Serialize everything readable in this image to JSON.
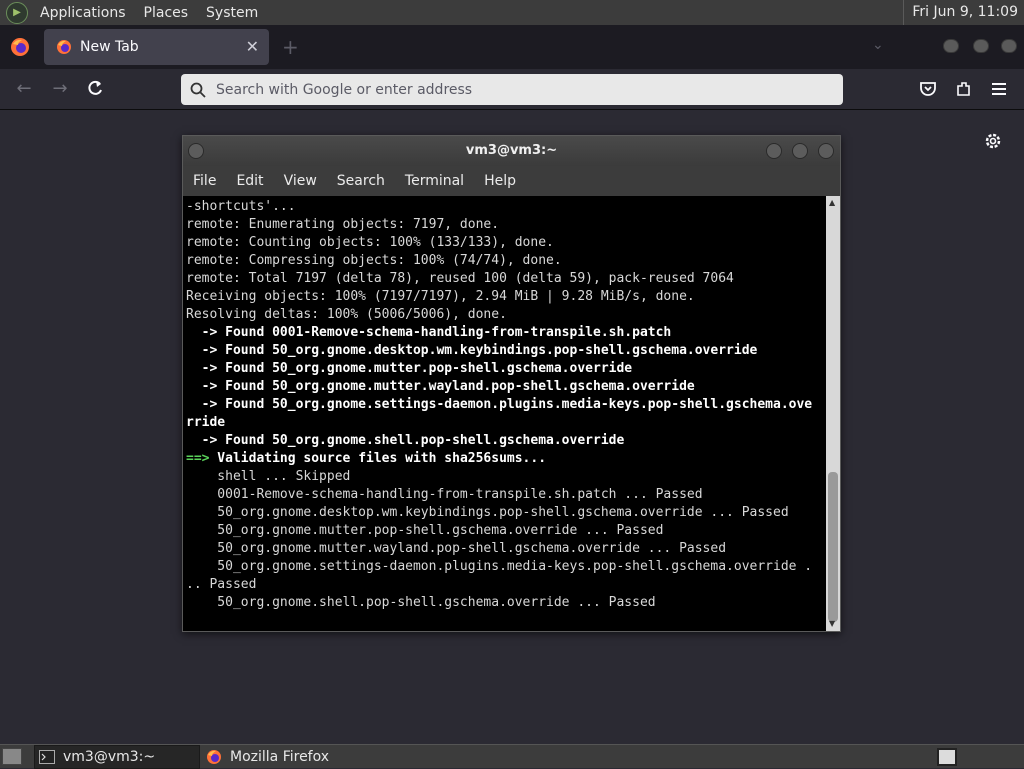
{
  "top_panel": {
    "menus": [
      "Applications",
      "Places",
      "System"
    ],
    "clock": "Fri Jun  9, 11:09"
  },
  "firefox": {
    "tab_title": "New Tab",
    "new_tab_symbol": "+",
    "close_symbol": "✕",
    "url_placeholder": "Search with Google or enter address"
  },
  "terminal": {
    "title": "vm3@vm3:~",
    "menus": [
      "File",
      "Edit",
      "View",
      "Search",
      "Terminal",
      "Help"
    ],
    "lines": [
      {
        "text": "-shortcuts'...",
        "style": "normal"
      },
      {
        "text": "remote: Enumerating objects: 7197, done.",
        "style": "normal"
      },
      {
        "text": "remote: Counting objects: 100% (133/133), done.",
        "style": "normal"
      },
      {
        "text": "remote: Compressing objects: 100% (74/74), done.",
        "style": "normal"
      },
      {
        "text": "remote: Total 7197 (delta 78), reused 100 (delta 59), pack-reused 7064",
        "style": "normal"
      },
      {
        "text": "Receiving objects: 100% (7197/7197), 2.94 MiB | 9.28 MiB/s, done.",
        "style": "normal"
      },
      {
        "text": "Resolving deltas: 100% (5006/5006), done.",
        "style": "normal"
      },
      {
        "text": "  -> Found 0001-Remove-schema-handling-from-transpile.sh.patch",
        "style": "bold"
      },
      {
        "text": "  -> Found 50_org.gnome.desktop.wm.keybindings.pop-shell.gschema.override",
        "style": "bold"
      },
      {
        "text": "  -> Found 50_org.gnome.mutter.pop-shell.gschema.override",
        "style": "bold"
      },
      {
        "text": "  -> Found 50_org.gnome.mutter.wayland.pop-shell.gschema.override",
        "style": "bold"
      },
      {
        "text": "  -> Found 50_org.gnome.settings-daemon.plugins.media-keys.pop-shell.gschema.ove",
        "style": "bold"
      },
      {
        "text": "rride",
        "style": "bold"
      },
      {
        "text": "  -> Found 50_org.gnome.shell.pop-shell.gschema.override",
        "style": "bold"
      },
      {
        "text": " Validating source files with sha256sums...",
        "style": "green",
        "prefix": "==>"
      },
      {
        "text": "    shell ... Skipped",
        "style": "normal"
      },
      {
        "text": "    0001-Remove-schema-handling-from-transpile.sh.patch ... Passed",
        "style": "normal"
      },
      {
        "text": "    50_org.gnome.desktop.wm.keybindings.pop-shell.gschema.override ... Passed",
        "style": "normal"
      },
      {
        "text": "    50_org.gnome.mutter.pop-shell.gschema.override ... Passed",
        "style": "normal"
      },
      {
        "text": "    50_org.gnome.mutter.wayland.pop-shell.gschema.override ... Passed",
        "style": "normal"
      },
      {
        "text": "    50_org.gnome.settings-daemon.plugins.media-keys.pop-shell.gschema.override .",
        "style": "normal"
      },
      {
        "text": ".. Passed",
        "style": "normal"
      },
      {
        "text": "    50_org.gnome.shell.pop-shell.gschema.override ... Passed",
        "style": "normal"
      }
    ]
  },
  "taskbar": {
    "tasks": [
      "vm3@vm3:~",
      "Mozilla Firefox"
    ]
  },
  "colors": {
    "terminal_bg": "#000000",
    "prompt_green": "#5ad35a",
    "firefox_chrome": "#1c1b22"
  }
}
